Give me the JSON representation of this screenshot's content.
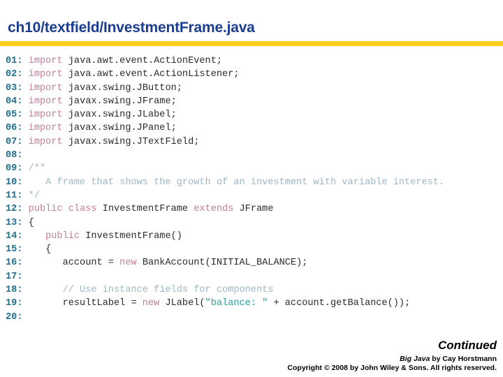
{
  "header": {
    "title": "ch10/textfield/InvestmentFrame.java",
    "title_color": "#1b3d8f",
    "rule_color": "#fbcd1c"
  },
  "code": {
    "syntax_colors": {
      "line_number": "#1f6e8c",
      "keyword": "#c07f9a",
      "string": "#2e9c9c",
      "comment": "#9fb6c4",
      "plain": "#2b2b2b"
    },
    "lines": [
      {
        "num": "01:",
        "tokens": [
          {
            "t": "plain",
            "s": " "
          },
          {
            "t": "kw",
            "s": "import"
          },
          {
            "t": "plain",
            "s": " java.awt.event.ActionEvent;"
          }
        ]
      },
      {
        "num": "02:",
        "tokens": [
          {
            "t": "plain",
            "s": " "
          },
          {
            "t": "kw",
            "s": "import"
          },
          {
            "t": "plain",
            "s": " java.awt.event.ActionListener;"
          }
        ]
      },
      {
        "num": "03:",
        "tokens": [
          {
            "t": "plain",
            "s": " "
          },
          {
            "t": "kw",
            "s": "import"
          },
          {
            "t": "plain",
            "s": " javax.swing.JButton;"
          }
        ]
      },
      {
        "num": "04:",
        "tokens": [
          {
            "t": "plain",
            "s": " "
          },
          {
            "t": "kw",
            "s": "import"
          },
          {
            "t": "plain",
            "s": " javax.swing.JFrame;"
          }
        ]
      },
      {
        "num": "05:",
        "tokens": [
          {
            "t": "plain",
            "s": " "
          },
          {
            "t": "kw",
            "s": "import"
          },
          {
            "t": "plain",
            "s": " javax.swing.JLabel;"
          }
        ]
      },
      {
        "num": "06:",
        "tokens": [
          {
            "t": "plain",
            "s": " "
          },
          {
            "t": "kw",
            "s": "import"
          },
          {
            "t": "plain",
            "s": " javax.swing.JPanel;"
          }
        ]
      },
      {
        "num": "07:",
        "tokens": [
          {
            "t": "plain",
            "s": " "
          },
          {
            "t": "kw",
            "s": "import"
          },
          {
            "t": "plain",
            "s": " javax.swing.JTextField;"
          }
        ]
      },
      {
        "num": "08:",
        "tokens": []
      },
      {
        "num": "09:",
        "tokens": [
          {
            "t": "cmt",
            "s": " /**"
          }
        ]
      },
      {
        "num": "10:",
        "tokens": [
          {
            "t": "cmt",
            "s": "    A frame that shows the growth of an investment with variable interest."
          }
        ]
      },
      {
        "num": "11:",
        "tokens": [
          {
            "t": "cmt",
            "s": " */"
          }
        ]
      },
      {
        "num": "12:",
        "tokens": [
          {
            "t": "plain",
            "s": " "
          },
          {
            "t": "kw",
            "s": "public class"
          },
          {
            "t": "plain",
            "s": " InvestmentFrame "
          },
          {
            "t": "kw",
            "s": "extends"
          },
          {
            "t": "plain",
            "s": " JFrame"
          }
        ]
      },
      {
        "num": "13:",
        "tokens": [
          {
            "t": "plain",
            "s": " {"
          }
        ]
      },
      {
        "num": "14:",
        "tokens": [
          {
            "t": "plain",
            "s": "    "
          },
          {
            "t": "kw",
            "s": "public"
          },
          {
            "t": "plain",
            "s": " InvestmentFrame()"
          }
        ]
      },
      {
        "num": "15:",
        "tokens": [
          {
            "t": "plain",
            "s": "    {"
          }
        ]
      },
      {
        "num": "16:",
        "tokens": [
          {
            "t": "plain",
            "s": "       account = "
          },
          {
            "t": "kw",
            "s": "new"
          },
          {
            "t": "plain",
            "s": " BankAccount(INITIAL_BALANCE);"
          }
        ]
      },
      {
        "num": "17:",
        "tokens": []
      },
      {
        "num": "18:",
        "tokens": [
          {
            "t": "cmt",
            "s": "       // Use instance fields for components"
          }
        ]
      },
      {
        "num": "19:",
        "tokens": [
          {
            "t": "plain",
            "s": "       resultLabel = "
          },
          {
            "t": "kw",
            "s": "new"
          },
          {
            "t": "plain",
            "s": " JLabel("
          },
          {
            "t": "str",
            "s": "\"balance: \""
          },
          {
            "t": "plain",
            "s": " + account.getBalance());"
          }
        ]
      },
      {
        "num": "20:",
        "tokens": []
      }
    ]
  },
  "footer": {
    "continued": "Continued",
    "credit_book": "Big Java",
    "credit_rest": " by Cay Horstmann",
    "copyright": "Copyright © 2008 by John Wiley & Sons.  All rights reserved."
  }
}
